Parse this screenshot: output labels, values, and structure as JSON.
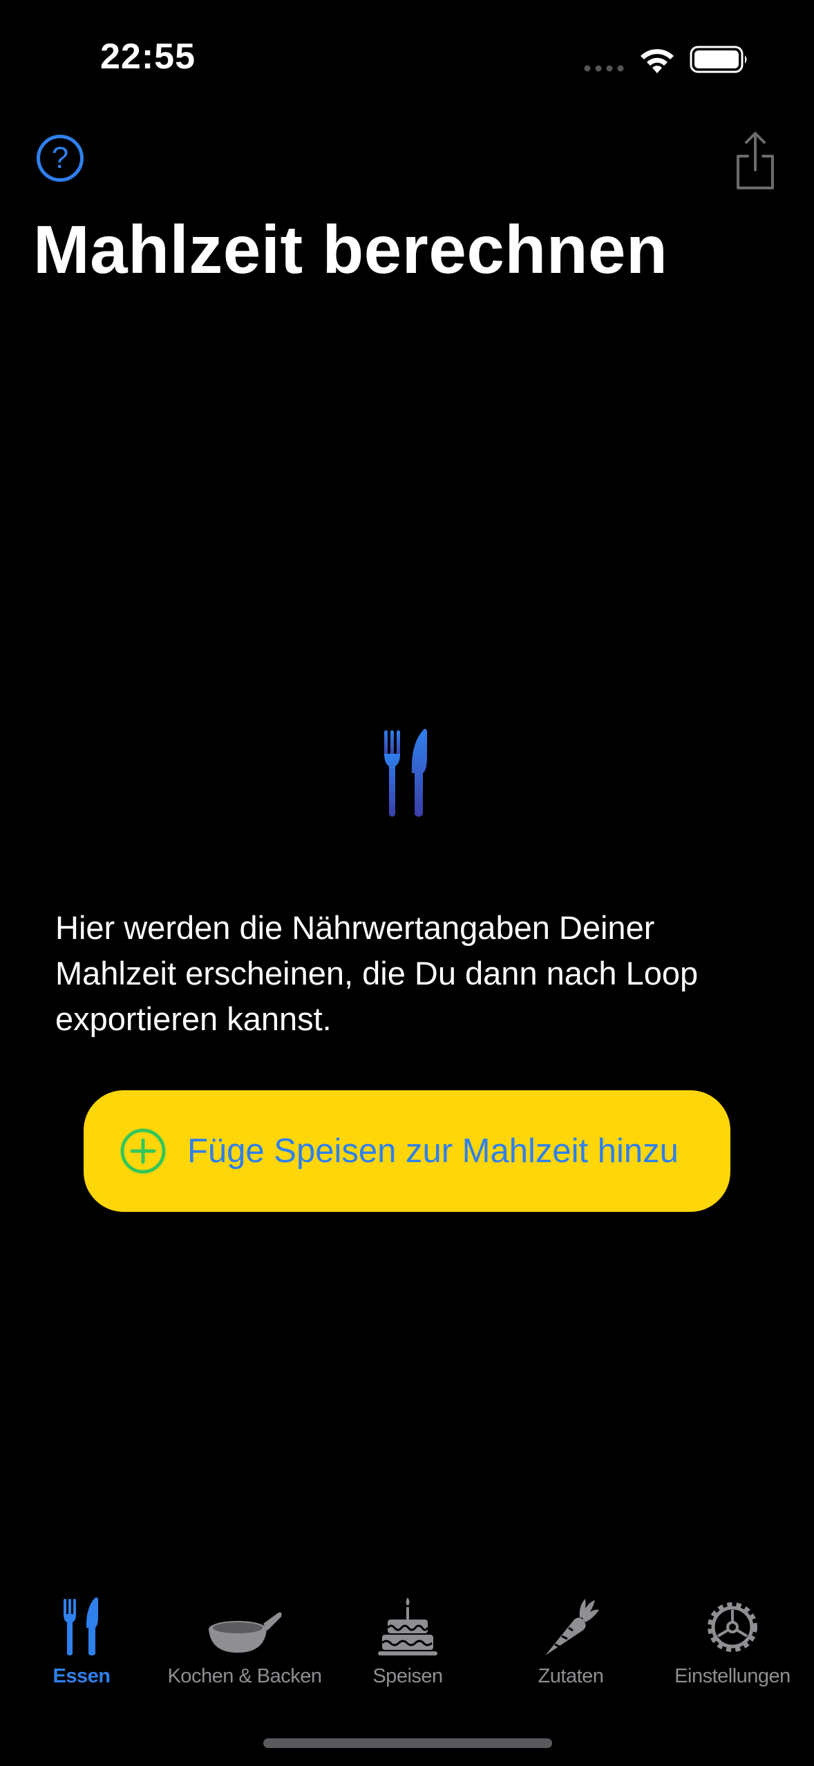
{
  "status_bar": {
    "time": "22:55"
  },
  "header": {
    "help_symbol": "?",
    "title": "Mahlzeit berechnen",
    "share_icon": "share-icon"
  },
  "empty_state": {
    "icon": "fork-knife-icon",
    "message": "Hier werden die Nährwertangaben Deiner Mahlzeit erscheinen, die Du dann nach Loop exportieren kannst.",
    "button_label": "Füge Speisen zur Mahlzeit hinzu"
  },
  "tabs": [
    {
      "label": "Essen",
      "icon": "fork-knife-icon",
      "active": true
    },
    {
      "label": "Kochen & Backen",
      "icon": "frying-pan-icon",
      "active": false
    },
    {
      "label": "Speisen",
      "icon": "birthday-cake-icon",
      "active": false
    },
    {
      "label": "Zutaten",
      "icon": "carrot-icon",
      "active": false
    },
    {
      "label": "Einstellungen",
      "icon": "gear-icon",
      "active": false
    }
  ],
  "colors": {
    "background": "#000000",
    "accent_blue": "#2f80ed",
    "button_yellow": "#ffd60a",
    "plus_green": "#34c759",
    "inactive_gray": "#8e8e93"
  }
}
